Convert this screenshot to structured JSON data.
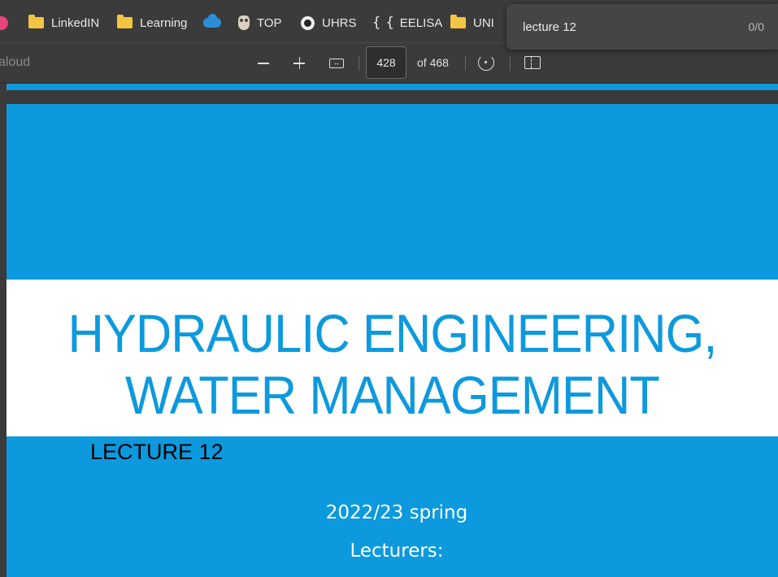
{
  "bookmarks": [
    {
      "label": "LinkedIN",
      "icon": "folder-icon"
    },
    {
      "label": "Learning",
      "icon": "folder-icon"
    },
    {
      "label": "",
      "icon": "onedrive-cloud-icon"
    },
    {
      "label": "TOP",
      "icon": "owl-icon"
    },
    {
      "label": "UHRS",
      "icon": "uhrs-icon"
    },
    {
      "label": "EELISA",
      "icon": "braces-icon"
    },
    {
      "label": "UNI",
      "icon": "folder-icon"
    }
  ],
  "toolbar": {
    "read_aloud_label": "aloud",
    "page_number": "428",
    "page_total": "of 468"
  },
  "find": {
    "query": "lecture 12",
    "count": "0/0"
  },
  "slide": {
    "title": "HYDRAULIC ENGINEERING, WATER MANAGEMENT",
    "lecture": "LECTURE 12",
    "semester": "2022/23 spring",
    "lecturers": "Lecturers:"
  },
  "colors": {
    "slide_blue": "#0d99dd",
    "chrome_dark": "#3b3b3b",
    "folder_yellow": "#f4c542"
  }
}
